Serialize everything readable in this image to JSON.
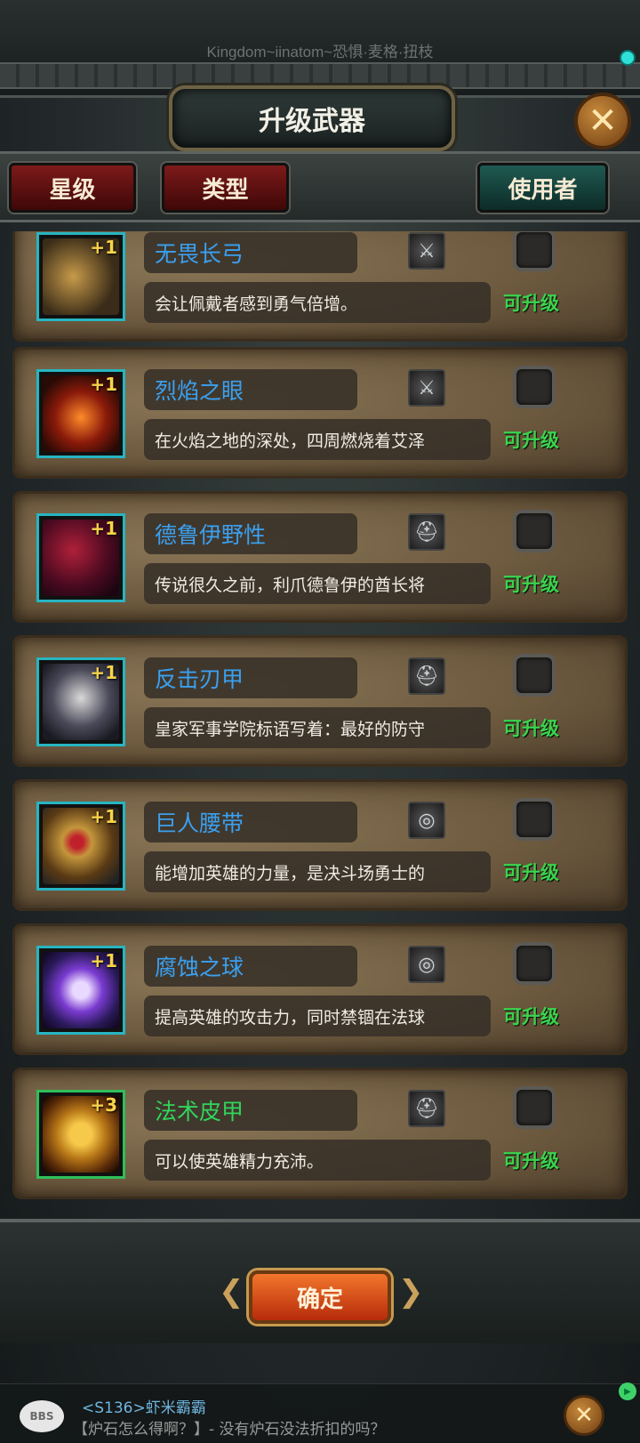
{
  "marquee": "Kingdom~iinatom~恐惧·麦格·扭枝",
  "title": "升级武器",
  "filters": [
    {
      "label": "星级"
    },
    {
      "label": "类型"
    },
    {
      "label": "使用者"
    }
  ],
  "items": [
    {
      "name": "无畏长弓",
      "desc": "会让佩戴者感到勇气倍增。",
      "plus": "+1",
      "type_icon": "dagger-icon",
      "status": "可升级",
      "name_color": "blue"
    },
    {
      "name": "烈焰之眼",
      "desc": "在火焰之地的深处，四周燃烧着艾泽",
      "plus": "+1",
      "type_icon": "dagger-icon",
      "status": "可升级",
      "name_color": "blue"
    },
    {
      "name": "德鲁伊野性",
      "desc": "传说很久之前，利爪德鲁伊的酋长将",
      "plus": "+1",
      "type_icon": "helmet-icon",
      "status": "可升级",
      "name_color": "blue"
    },
    {
      "name": "反击刃甲",
      "desc": "皇家军事学院标语写着：最好的防守",
      "plus": "+1",
      "type_icon": "helmet-icon",
      "status": "可升级",
      "name_color": "blue"
    },
    {
      "name": "巨人腰带",
      "desc": "能增加英雄的力量，是决斗场勇士的",
      "plus": "+1",
      "type_icon": "ring-icon",
      "status": "可升级",
      "name_color": "blue"
    },
    {
      "name": "腐蚀之球",
      "desc": "提高英雄的攻击力，同时禁锢在法球",
      "plus": "+1",
      "type_icon": "ring-icon",
      "status": "可升级",
      "name_color": "blue"
    },
    {
      "name": "法术皮甲",
      "desc": "可以使英雄精力充沛。",
      "plus": "+3",
      "type_icon": "helmet-icon",
      "status": "可升级",
      "name_color": "green"
    }
  ],
  "confirm_label": "确定",
  "chat": {
    "badge": "BBS",
    "name": "<S136>虾米霸霸",
    "message": "【炉石怎么得啊？】- 没有炉石没法折扣的吗？"
  },
  "colors": {
    "name_blue": "#3aa0f0",
    "name_green": "#32d45a",
    "upgradable": "#3ad44d",
    "confirm": "#e0581c"
  }
}
